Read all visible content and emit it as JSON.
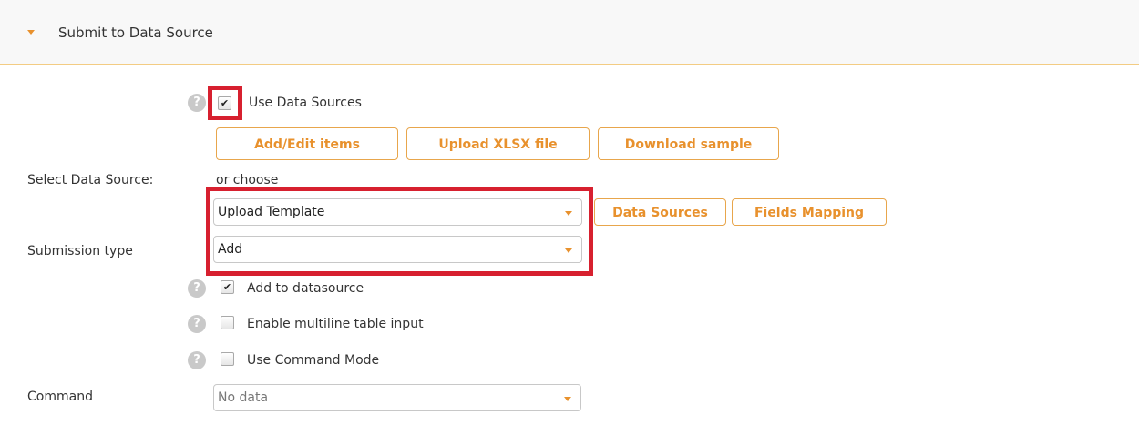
{
  "section": {
    "title": "Submit to Data Source"
  },
  "use_data_sources": {
    "label": "Use Data Sources",
    "checked": true
  },
  "buttons": {
    "add_edit": "Add/Edit items",
    "upload_xlsx": "Upload XLSX file",
    "download_sample": "Download sample",
    "data_sources": "Data Sources",
    "fields_mapping": "Fields Mapping"
  },
  "select_data_source": {
    "label": "Select Data Source:",
    "or_choose": "or choose",
    "value": "Upload Template"
  },
  "submission_type": {
    "label": "Submission type",
    "value": "Add"
  },
  "options": [
    {
      "label": "Add to datasource",
      "checked": true
    },
    {
      "label": "Enable multiline table input",
      "checked": false
    },
    {
      "label": "Use Command Mode",
      "checked": false
    }
  ],
  "command": {
    "label": "Command",
    "placeholder": "No data"
  },
  "help_glyph": "?",
  "check_glyph": "✔",
  "colors": {
    "accent": "#e8912d",
    "highlight": "#d7202f"
  }
}
